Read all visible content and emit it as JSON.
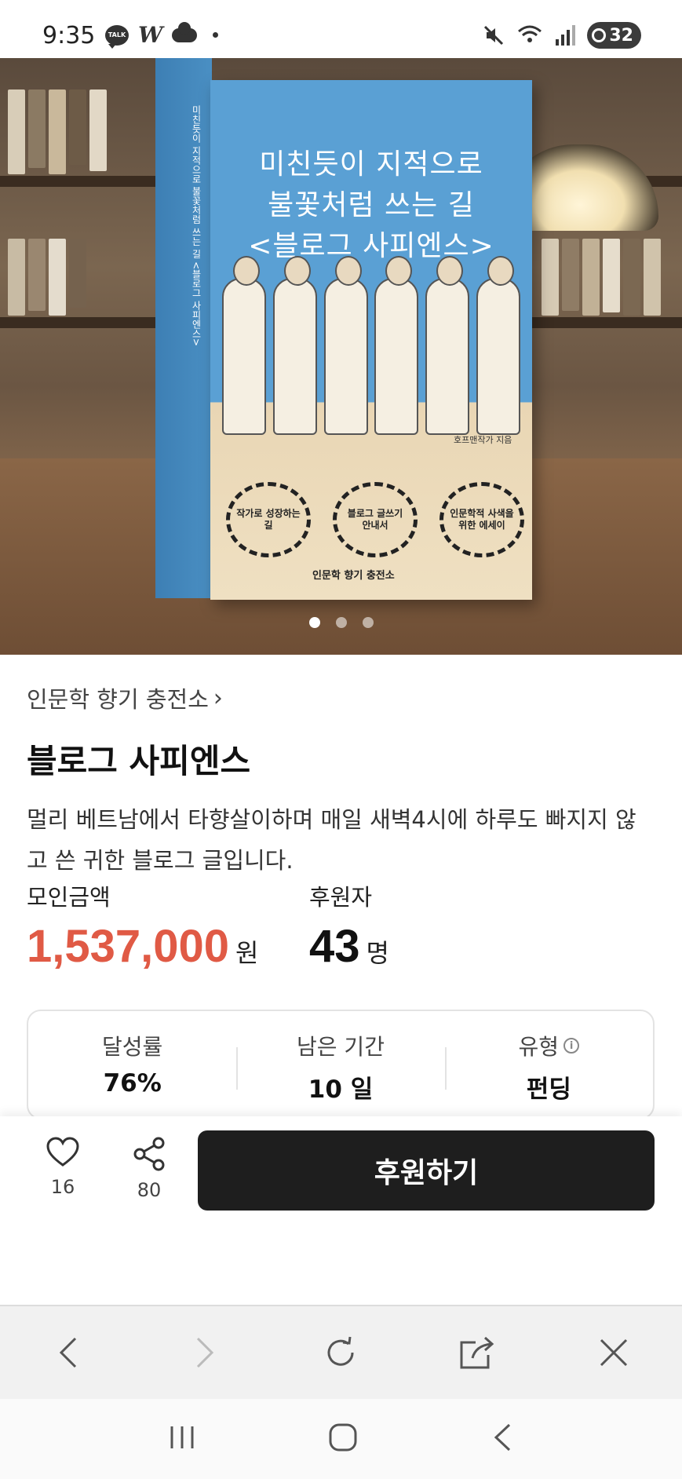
{
  "status_bar": {
    "time": "9:35",
    "talk_label": "TALK",
    "w_label": "W",
    "battery": "32"
  },
  "hero": {
    "book_title_lines": [
      "미친듯이 지적으로",
      "불꽃처럼 쓰는 길",
      "<블로그 사피엔스>"
    ],
    "book_author": "호프맨작가 지음",
    "book_side_text": "미친듯이 지적으로 불꽃처럼 쓰는 길 <블로그 사피엔스>",
    "badges": [
      "작가로 성장하는 길",
      "블로그 글쓰기 안내서",
      "인문학적 사색을 위한 에세이"
    ],
    "publisher": "인문학 향기 충전소",
    "carousel_index": 1,
    "carousel_total": 3
  },
  "project": {
    "creator": "인문학 향기 충전소",
    "title": "블로그 사피엔스",
    "description": "멀리 베트남에서 타향살이하며 매일 새벽4시에 하루도 빠지지 않고 쓴 귀한 블로그 글입니다.",
    "amount_label": "모인금액",
    "amount_value": "1,537,000",
    "amount_unit": "원",
    "backers_label": "후원자",
    "backers_value": "43",
    "backers_unit": "명"
  },
  "stats": {
    "achievement_label": "달성률",
    "achievement_value": "76%",
    "remaining_label": "남은 기간",
    "remaining_value": "10 일",
    "type_label": "유형",
    "type_value": "펀딩"
  },
  "actions": {
    "like_count": "16",
    "share_count": "80",
    "back_label": "후원하기"
  },
  "colors": {
    "accent_amount": "#e05a45",
    "button_dark": "#1e1e1e"
  }
}
